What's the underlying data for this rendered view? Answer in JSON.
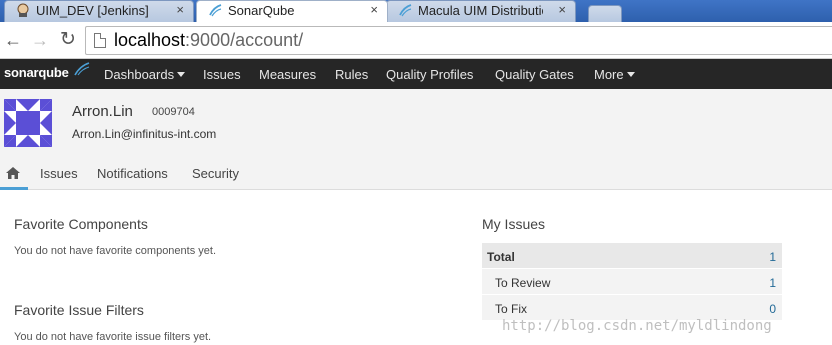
{
  "browser": {
    "tabs": [
      {
        "label": "UIM_DEV [Jenkins]",
        "icon": "jenkins-icon",
        "active": false
      },
      {
        "label": "SonarQube",
        "icon": "sonarqube-icon",
        "active": true
      },
      {
        "label": "Macula UIM Distribution",
        "icon": "sonarqube-icon",
        "active": false
      }
    ],
    "close_glyph": "×",
    "url_host": "localhost",
    "url_rest": ":9000/account/"
  },
  "sonar": {
    "logo_text": "sonarqube",
    "nav": [
      {
        "label": "Dashboards",
        "dropdown": true
      },
      {
        "label": "Issues",
        "dropdown": false
      },
      {
        "label": "Measures",
        "dropdown": false
      },
      {
        "label": "Rules",
        "dropdown": false
      },
      {
        "label": "Quality Profiles",
        "dropdown": false
      },
      {
        "label": "Quality Gates",
        "dropdown": false
      },
      {
        "label": "More",
        "dropdown": true
      }
    ]
  },
  "account": {
    "name": "Arron.Lin",
    "id": "0009704",
    "email": "Arron.Lin@infinitus-int.com",
    "tabs": [
      "Issues",
      "Notifications",
      "Security"
    ]
  },
  "favorites": {
    "components_title": "Favorite Components",
    "components_empty": "You do not have favorite components yet.",
    "filters_title": "Favorite Issue Filters",
    "filters_empty": "You do not have favorite issue filters yet."
  },
  "my_issues": {
    "title": "My Issues",
    "rows": [
      {
        "label": "Total",
        "value": "1"
      },
      {
        "label": "To Review",
        "value": "1"
      },
      {
        "label": "To Fix",
        "value": "0"
      }
    ]
  },
  "watermark": "http://blog.csdn.net/myldlindong",
  "colors": {
    "accent": "#4b9fd5",
    "nav_bg": "#262626",
    "avatar": "#5b4fd6",
    "link": "#236a97"
  }
}
